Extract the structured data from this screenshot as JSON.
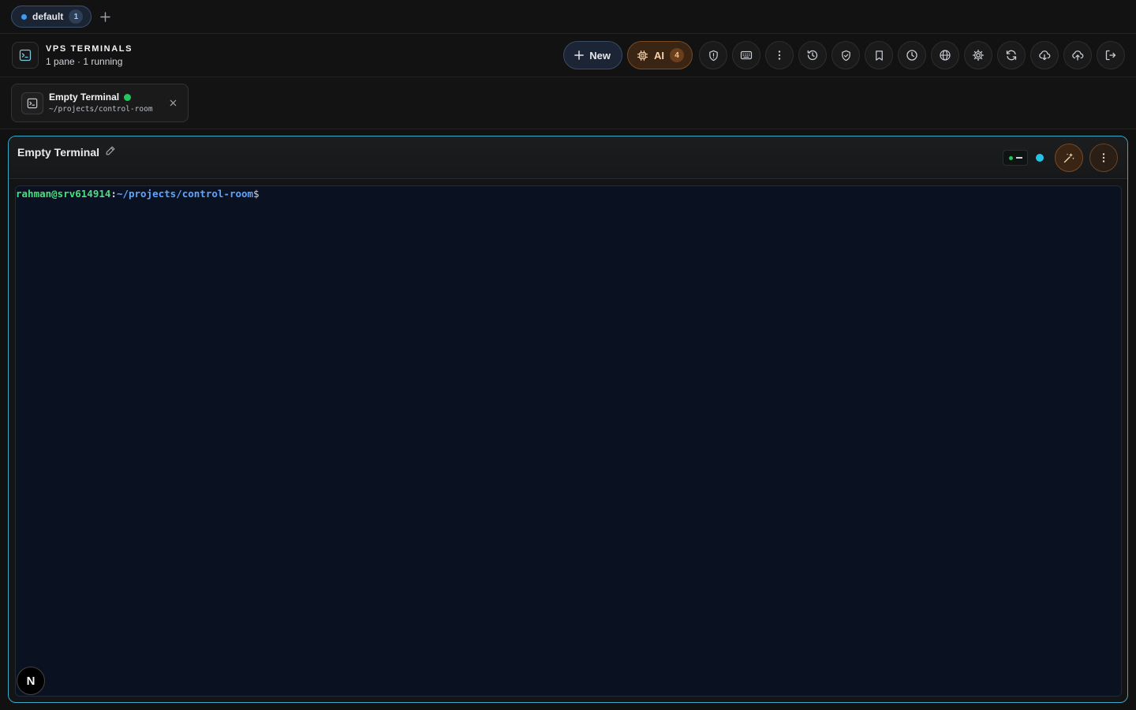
{
  "session": {
    "name": "default",
    "count": "1"
  },
  "header": {
    "title": "VPS TERMINALS",
    "subtitle": "1 pane · 1 running"
  },
  "toolbar": {
    "new_label": "New",
    "ai_label": "AI",
    "ai_count": "4",
    "icons": [
      "shield-icon",
      "keyboard-icon",
      "more-vertical-icon",
      "history-icon",
      "shield-check-icon",
      "bookmark-icon",
      "clock-icon",
      "globe-icon",
      "settings-icon",
      "refresh-icon",
      "cloud-download-icon",
      "cloud-upload-icon",
      "logout-icon"
    ]
  },
  "tab": {
    "title": "Empty Terminal",
    "path": "~/projects/control-room",
    "close": "×"
  },
  "pane": {
    "title": "Empty Terminal"
  },
  "terminal": {
    "user_host": "rahman@srv614914",
    "colon": ":",
    "cwd": "~/projects/control-room",
    "dollar": "$"
  },
  "badge": {
    "letter": "N"
  },
  "colors": {
    "accent": "#3ba9c9",
    "ai": "#7a4a22",
    "running": "#22c55e",
    "terminal_bg": "#0a1120"
  }
}
